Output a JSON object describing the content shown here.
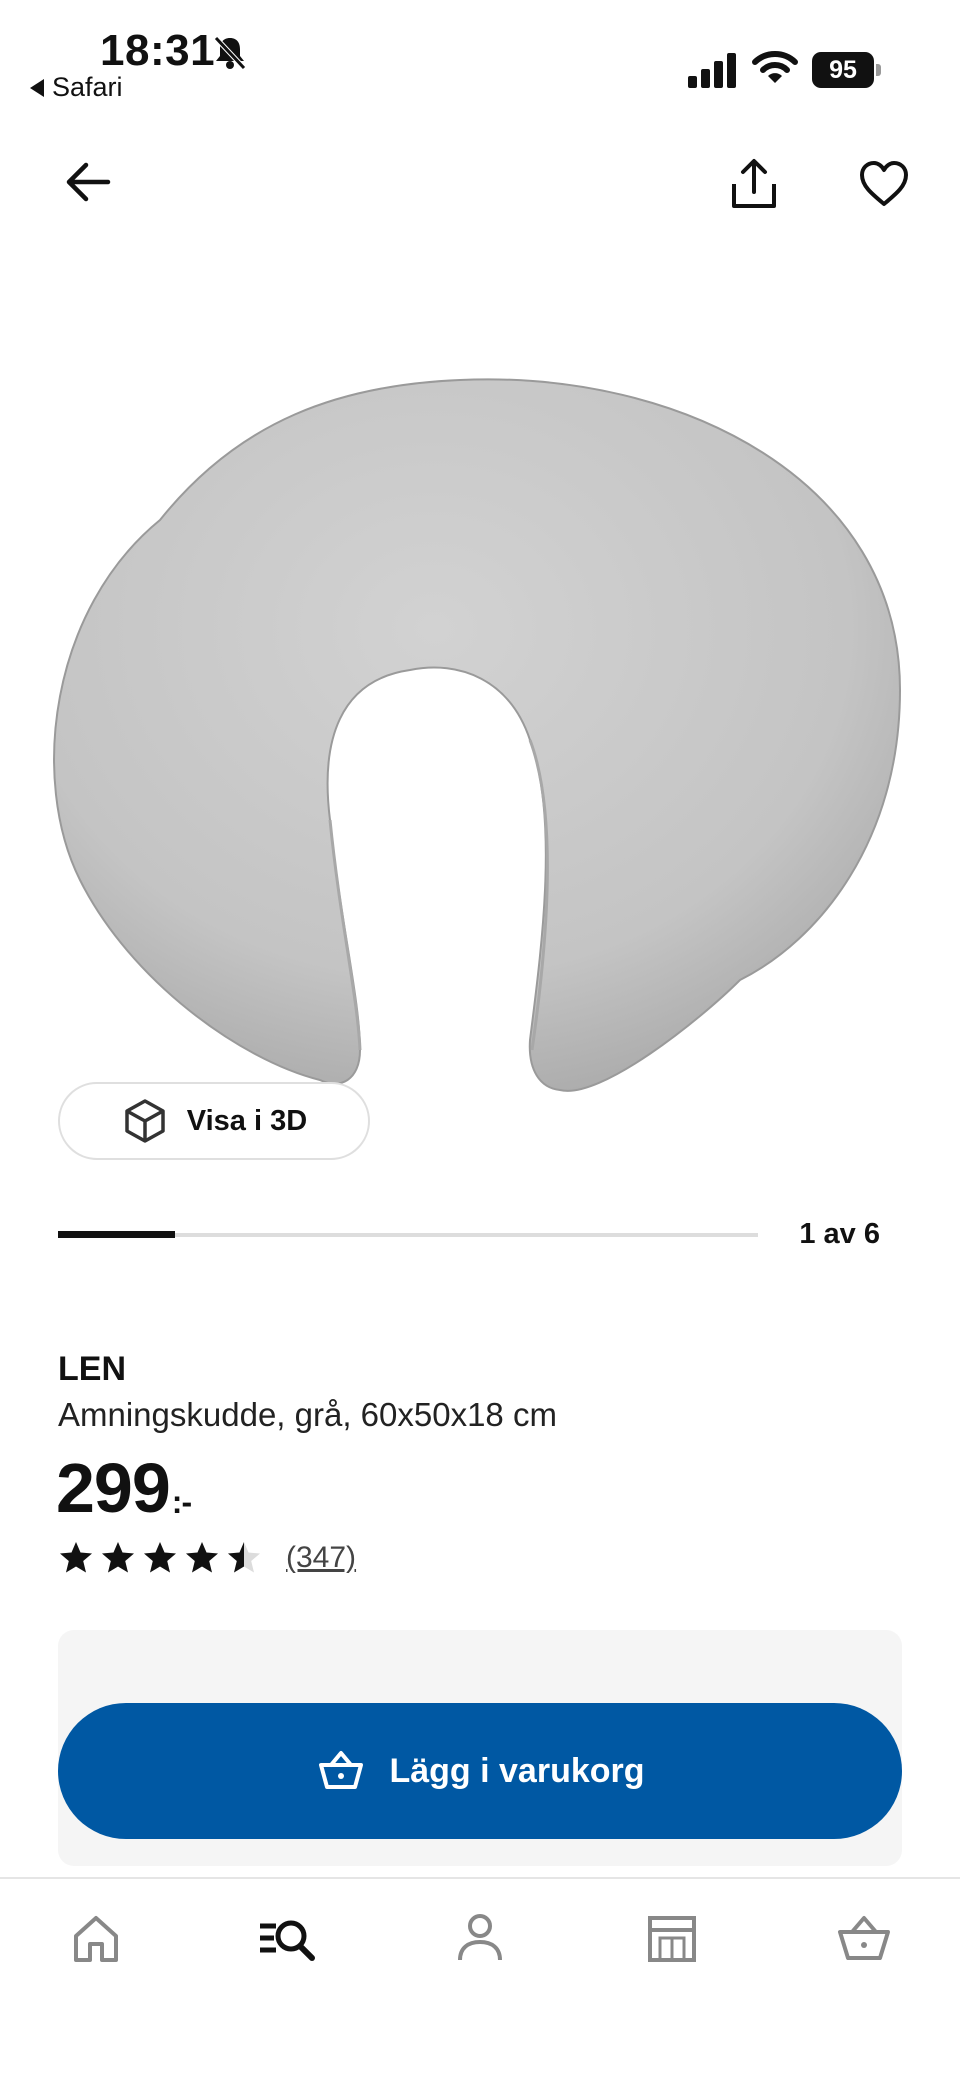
{
  "status_bar": {
    "time": "18:31",
    "back_app": "Safari",
    "battery": "95"
  },
  "product": {
    "name": "LEN",
    "description": "Amningskudde, grå, 60x50x18 cm",
    "price": "299",
    "price_suffix": ":-",
    "rating": 4.5,
    "rating_max": 5,
    "review_count": "(347)"
  },
  "gallery": {
    "view_3d_label": "Visa i 3D",
    "position_text": "1 av 6",
    "current": 1,
    "total": 6
  },
  "cart": {
    "button_label": "Lägg i varukorg"
  },
  "colors": {
    "primary_blue": "#0058a3",
    "panel_bg": "#f5f5f5",
    "text": "#111111"
  },
  "icons": {
    "nav": [
      "back-arrow-icon",
      "share-icon",
      "heart-icon"
    ],
    "tabs": [
      "home-icon",
      "search-icon",
      "profile-icon",
      "store-icon",
      "basket-icon"
    ]
  }
}
